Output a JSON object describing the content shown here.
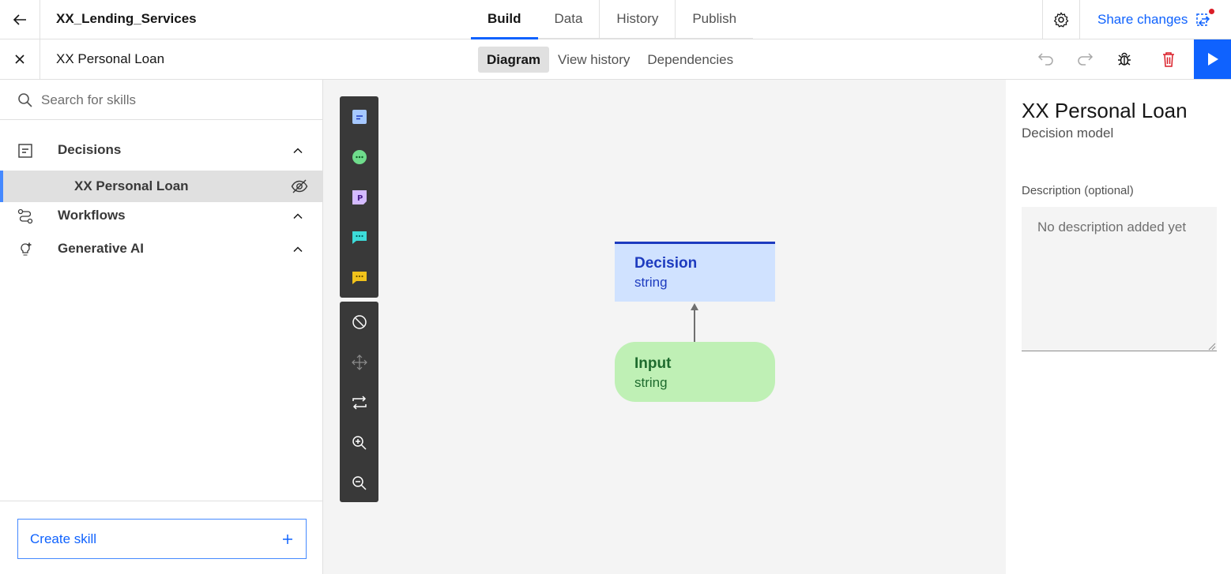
{
  "header": {
    "project_title": "XX_Lending_Services",
    "tabs": [
      {
        "label": "Build",
        "active": true
      },
      {
        "label": "Data",
        "active": false
      },
      {
        "label": "History",
        "active": false
      },
      {
        "label": "Publish",
        "active": false
      }
    ],
    "share_label": "Share changes"
  },
  "subheader": {
    "model_title": "XX Personal Loan",
    "tabs": [
      {
        "label": "Diagram",
        "active": true
      },
      {
        "label": "View history",
        "active": false
      },
      {
        "label": "Dependencies",
        "active": false
      }
    ]
  },
  "sidebar": {
    "search_placeholder": "Search for skills",
    "sections": [
      {
        "label": "Decisions",
        "icon": "document-icon",
        "expanded": true
      },
      {
        "label": "Workflows",
        "icon": "flow-icon",
        "expanded": true
      },
      {
        "label": "Generative AI",
        "icon": "ai-bulb-icon",
        "expanded": true
      }
    ],
    "selected_item": "XX Personal Loan",
    "create_button_label": "Create skill"
  },
  "palette": {
    "node_types": [
      "decision-node-icon",
      "input-node-icon",
      "function-node-icon",
      "comment-node-icon",
      "note-node-icon"
    ],
    "tools": [
      "clear-icon",
      "move-icon",
      "reorient-icon",
      "zoom-in-icon",
      "zoom-out-icon"
    ]
  },
  "diagram": {
    "decision_node": {
      "title": "Decision",
      "type": "string"
    },
    "input_node": {
      "title": "Input",
      "type": "string"
    }
  },
  "details_panel": {
    "title": "XX Personal Loan",
    "subtitle": "Decision model",
    "description_label": "Description (optional)",
    "description_placeholder": "No description added yet"
  },
  "colors": {
    "accent": "#0f62fe",
    "decision_fill": "#d0e2ff",
    "decision_text": "#1d3bbf",
    "input_fill": "#bff0b5",
    "input_text": "#1e6b2e",
    "delete_red": "#da1e28"
  }
}
